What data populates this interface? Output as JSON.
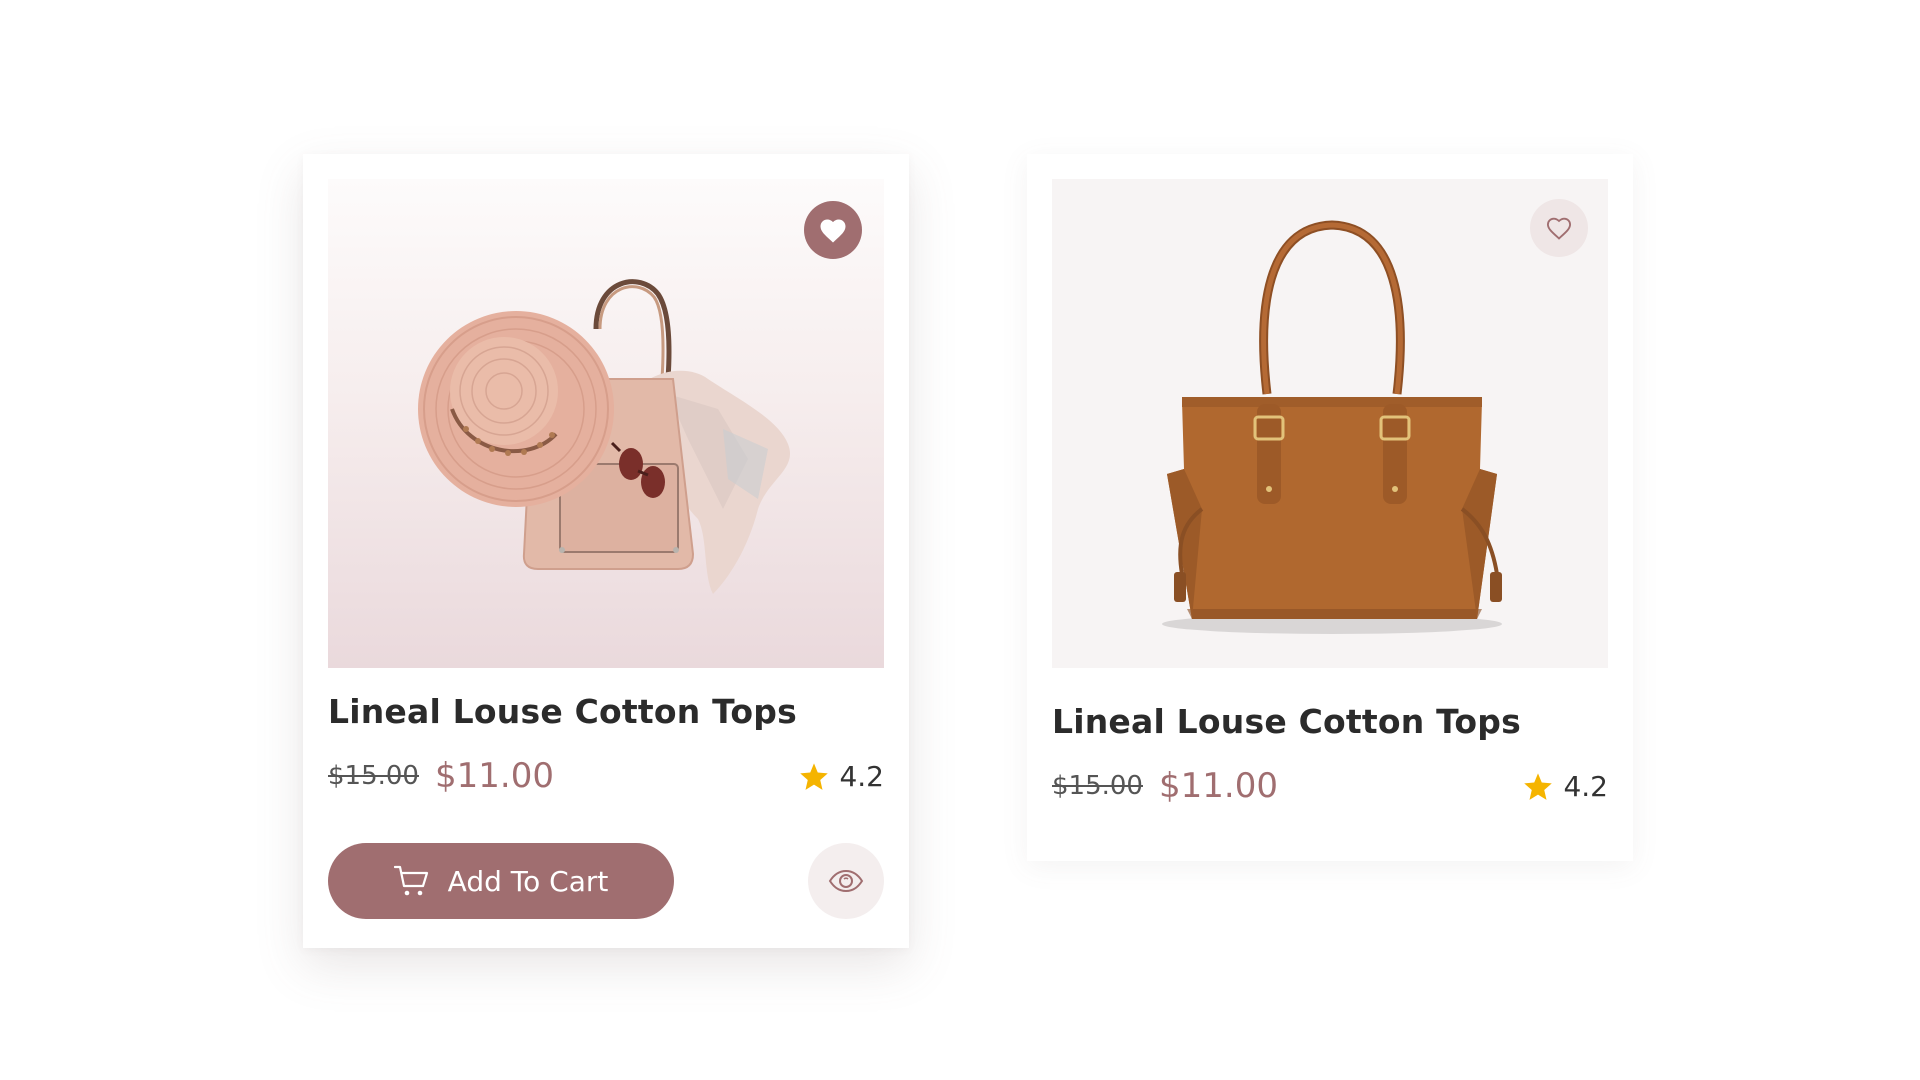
{
  "colors": {
    "accent": "#a06e70",
    "star": "#f5b400",
    "text": "#2b2b2b",
    "fav_inactive_bg": "#efe6e6"
  },
  "products": [
    {
      "title": "Lineal Louse Cotton Tops",
      "old_price": "$15.00",
      "new_price": "$11.00",
      "rating": "4.2",
      "favorited": true,
      "image": "hat-bag-scarf-sunglasses",
      "cart_label": "Add To Cart",
      "icons": {
        "favorite": "heart-filled-icon",
        "cart": "cart-icon",
        "view": "eye-icon",
        "rating": "star-icon"
      }
    },
    {
      "title": "Lineal Louse Cotton Tops",
      "old_price": "$15.00",
      "new_price": "$11.00",
      "rating": "4.2",
      "favorited": false,
      "image": "brown-leather-tote",
      "icons": {
        "favorite": "heart-outline-icon",
        "rating": "star-icon"
      }
    }
  ]
}
